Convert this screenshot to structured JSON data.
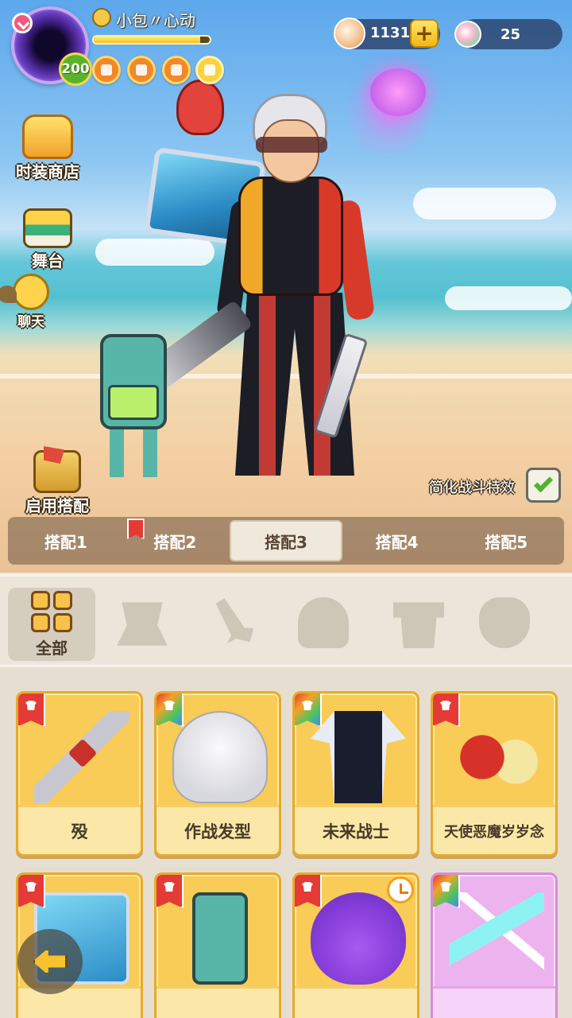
{
  "player": {
    "name": "小包〃心动",
    "level": "200",
    "exp_progress": 0.92
  },
  "currency": {
    "shells": "1131",
    "plus_label": "+",
    "gems": "25"
  },
  "side_menu": {
    "shop_label": "时装商店",
    "stage_label": "舞台",
    "chat_label": "聊天"
  },
  "actions": {
    "apply_outfit_label": "启用搭配",
    "simplify_effects_label": "简化战斗特效",
    "simplify_effects_checked": true
  },
  "outfit_tabs": [
    {
      "label": "搭配1"
    },
    {
      "label": "搭配2"
    },
    {
      "label": "搭配3"
    },
    {
      "label": "搭配4"
    },
    {
      "label": "搭配5"
    }
  ],
  "active_outfit_index": 2,
  "categories": {
    "all_label": "全部"
  },
  "items": [
    {
      "name": "殁",
      "icon": "sword-icon"
    },
    {
      "name": "作战发型",
      "icon": "hair-icon"
    },
    {
      "name": "未来战士",
      "icon": "suit-icon"
    },
    {
      "name": "天使恶魔岁岁念",
      "icon": "pets-icon"
    },
    {
      "name": "",
      "icon": "backpack-gear-icon"
    },
    {
      "name": "",
      "icon": "robot-pet-icon"
    },
    {
      "name": "",
      "icon": "devil-slime-icon"
    },
    {
      "name": "",
      "icon": "blade-icon"
    }
  ],
  "colors": {
    "accent_gold": "#f8cc57",
    "rare_pink": "#edb3ef",
    "tag_red": "#e53b36",
    "check_green": "#4fb42c"
  }
}
